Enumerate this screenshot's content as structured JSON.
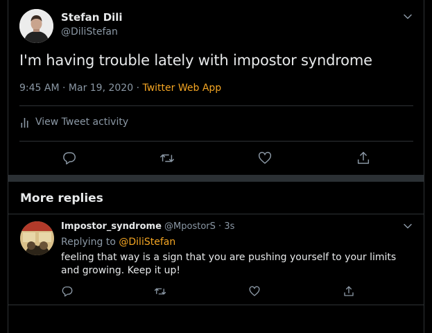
{
  "main_tweet": {
    "author_name": "Stefan Dili",
    "author_handle": "@DiliStefan",
    "text": "I'm having trouble lately with impostor syndrome",
    "time": "9:45 AM",
    "separator": "·",
    "date": "Mar 19, 2020",
    "source_separator": "·",
    "source": "Twitter Web App",
    "activity_label": "View Tweet activity"
  },
  "section": {
    "more_replies_title": "More replies"
  },
  "reply": {
    "author_name": "Impostor_syndrome",
    "author_handle": "@MpostorS",
    "separator": "·",
    "time": "3s",
    "replying_prefix": "Replying to",
    "replying_to": "@DiliStefan",
    "text": "feeling that way is a sign that you are pushing yourself to your limits and growing. Keep it up!"
  },
  "icons": {
    "caret": "chevron-down-icon",
    "reply": "reply-icon",
    "retweet": "retweet-icon",
    "like": "heart-icon",
    "share": "share-icon",
    "activity": "bar-chart-icon"
  },
  "colors": {
    "background": "#000000",
    "text": "#e7e9ea",
    "secondary": "#8b98a5",
    "accent": "#f5a623",
    "divider": "#2f3336"
  }
}
